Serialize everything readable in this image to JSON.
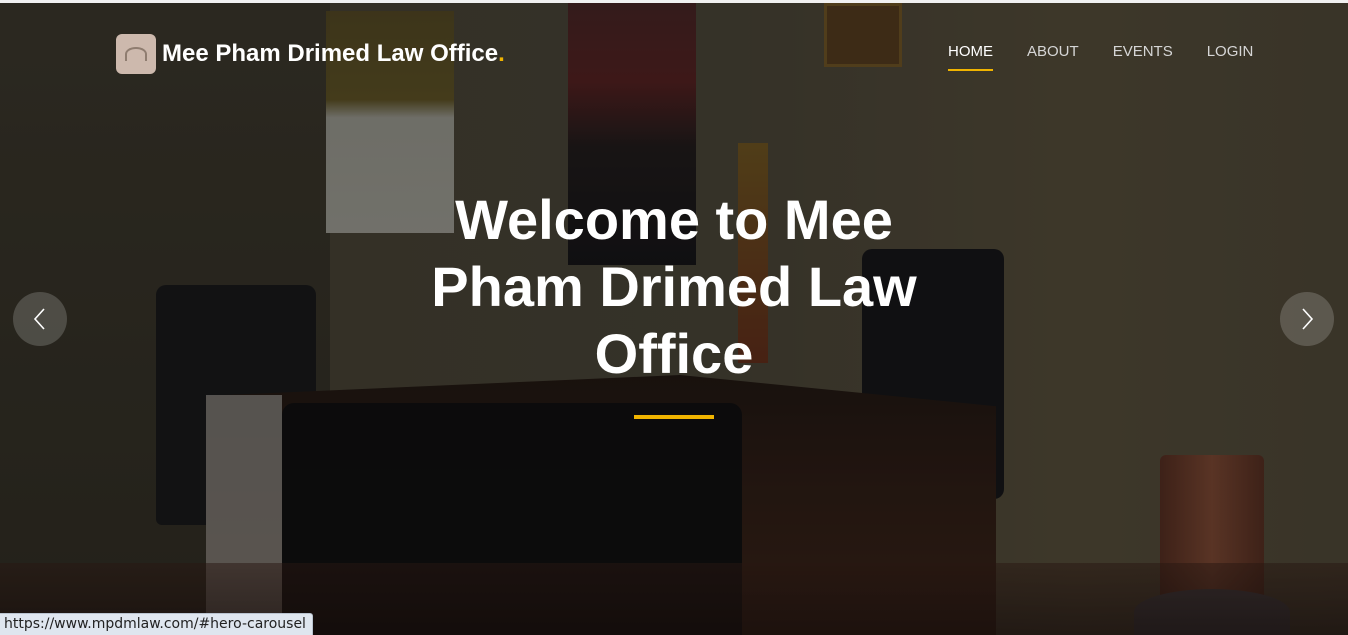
{
  "header": {
    "brand_name": "Mee Pham Drimed Law Office",
    "brand_dot": ".",
    "logo_icon": "law-office-logo"
  },
  "nav": {
    "items": [
      {
        "label": "HOME",
        "active": true
      },
      {
        "label": "ABOUT",
        "active": false
      },
      {
        "label": "EVENTS",
        "active": false
      },
      {
        "label": "LOGIN",
        "active": false
      }
    ]
  },
  "hero": {
    "title": "Welcome to Mee Pham Drimed Law Office",
    "prev_icon": "chevron-left-icon",
    "next_icon": "chevron-right-icon"
  },
  "statusbar": {
    "url": "https://www.mpdmlaw.com/#hero-carousel"
  },
  "colors": {
    "accent": "#f0b400",
    "text": "#ffffff",
    "nav_inactive": "#d6d6d6"
  }
}
